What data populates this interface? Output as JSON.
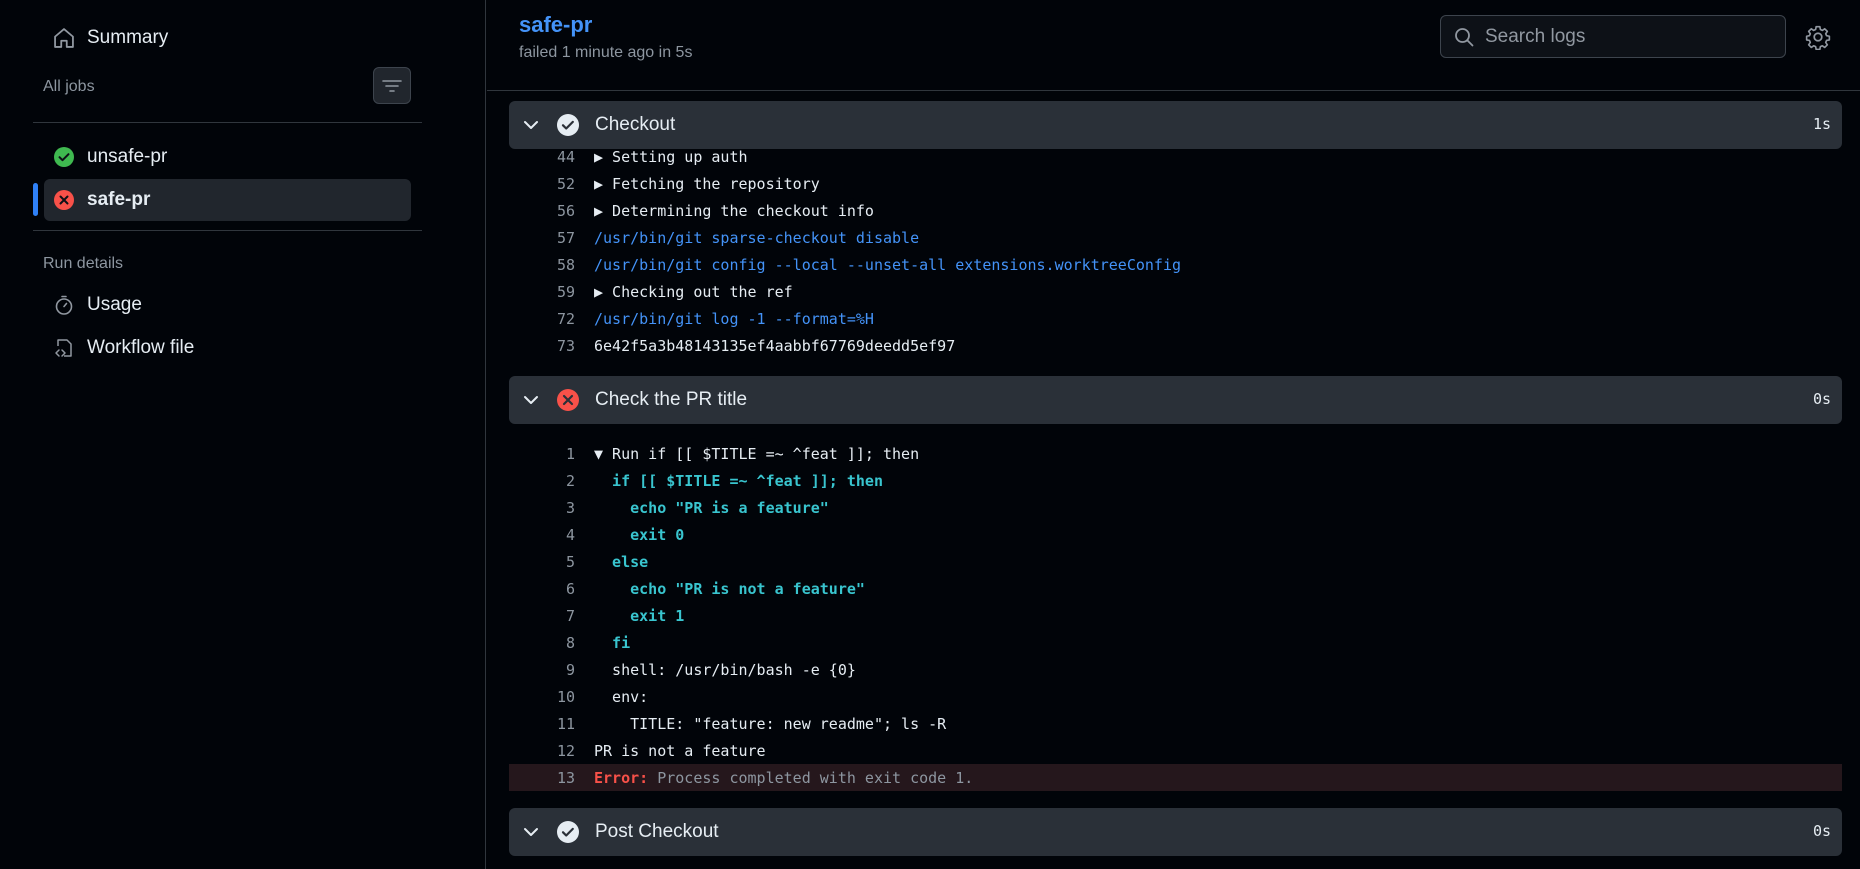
{
  "sidebar": {
    "summary_label": "Summary",
    "all_jobs_label": "All jobs",
    "jobs": [
      {
        "name": "unsafe-pr",
        "status": "success"
      },
      {
        "name": "safe-pr",
        "status": "failure",
        "active": true
      }
    ],
    "run_details_label": "Run details",
    "usage_label": "Usage",
    "workflow_file_label": "Workflow file"
  },
  "header": {
    "title": "safe-pr",
    "subtitle": "failed 1 minute ago in 5s",
    "search_placeholder": "Search logs"
  },
  "steps": [
    {
      "name": "Checkout",
      "status": "success",
      "duration": "1s",
      "lines": [
        {
          "n": "44",
          "text": "▶ Setting up auth",
          "kind": "group"
        },
        {
          "n": "52",
          "text": "▶ Fetching the repository",
          "kind": "group"
        },
        {
          "n": "56",
          "text": "▶ Determining the checkout info",
          "kind": "group"
        },
        {
          "n": "57",
          "text": "/usr/bin/git sparse-checkout disable",
          "kind": "cmd"
        },
        {
          "n": "58",
          "text": "/usr/bin/git config --local --unset-all extensions.worktreeConfig",
          "kind": "cmd"
        },
        {
          "n": "59",
          "text": "▶ Checking out the ref",
          "kind": "group"
        },
        {
          "n": "72",
          "text": "/usr/bin/git log -1 --format=%H",
          "kind": "cmd"
        },
        {
          "n": "73",
          "text": "6e42f5a3b48143135ef4aabbf67769deedd5ef97",
          "kind": "plain"
        }
      ]
    },
    {
      "name": "Check the PR title",
      "status": "failure",
      "duration": "0s",
      "lines": [
        {
          "n": "1",
          "text": "▼ Run if [[ $TITLE =~ ^feat ]]; then",
          "kind": "group"
        },
        {
          "n": "2",
          "text": "  if [[ $TITLE =~ ^feat ]]; then",
          "kind": "cyan"
        },
        {
          "n": "3",
          "text": "    echo \"PR is a feature\"",
          "kind": "cyan"
        },
        {
          "n": "4",
          "text": "    exit 0",
          "kind": "cyan"
        },
        {
          "n": "5",
          "text": "  else",
          "kind": "cyan"
        },
        {
          "n": "6",
          "text": "    echo \"PR is not a feature\"",
          "kind": "cyan"
        },
        {
          "n": "7",
          "text": "    exit 1",
          "kind": "cyan"
        },
        {
          "n": "8",
          "text": "  fi",
          "kind": "cyan"
        },
        {
          "n": "9",
          "text": "  shell: /usr/bin/bash -e {0}",
          "kind": "plain"
        },
        {
          "n": "10",
          "text": "  env:",
          "kind": "plain"
        },
        {
          "n": "11",
          "text": "    TITLE: \"feature: new readme\"; ls -R",
          "kind": "plain"
        },
        {
          "n": "12",
          "text": "PR is not a feature",
          "kind": "plain"
        }
      ],
      "error_line": {
        "n": "13",
        "label": "Error:",
        "message": "Process completed with exit code 1."
      }
    },
    {
      "name": "Post Checkout",
      "status": "success",
      "duration": "0s"
    }
  ],
  "colors": {
    "success": "#3fb950",
    "failure": "#f85149",
    "accent": "#2f81f7"
  }
}
